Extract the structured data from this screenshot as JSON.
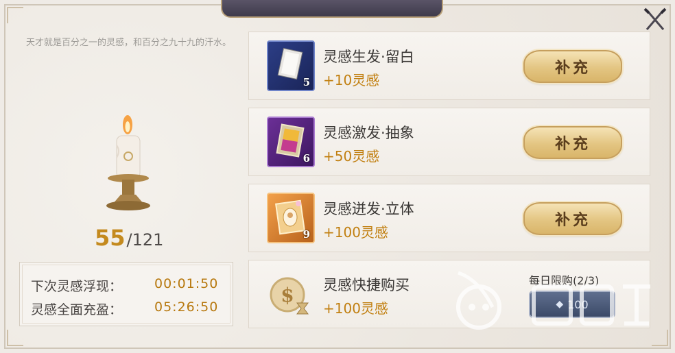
{
  "quote": "天才就是百分之一的灵感，和百分之九十九的汗水。",
  "inspiration": {
    "current": "55",
    "separator": "/",
    "max": "121"
  },
  "timers": [
    {
      "label": "下次灵感浮现：",
      "value": "00:01:50"
    },
    {
      "label": "灵感全面充盈：",
      "value": "05:26:50"
    }
  ],
  "items": [
    {
      "title": "灵感生发·留白",
      "reward": "+10灵感",
      "badge": "5",
      "button": "补充",
      "icon": "blank-canvas-icon"
    },
    {
      "title": "灵感激发·抽象",
      "reward": "+50灵感",
      "badge": "6",
      "button": "补充",
      "icon": "abstract-painting-icon"
    },
    {
      "title": "灵感迸发·立体",
      "reward": "+100灵感",
      "badge": "9",
      "button": "补充",
      "icon": "framed-portrait-icon"
    }
  ],
  "quick_buy": {
    "title": "灵感快捷购买",
    "reward": "+100灵感",
    "limit": "每日限购(2/3)",
    "price": "100",
    "icon": "coin-hourglass-icon"
  },
  "colors": {
    "accent_gold": "#c17f10",
    "timer_value": "#b7780e",
    "button_gold": "#e3c582",
    "quick_button": "#3c4a68"
  }
}
